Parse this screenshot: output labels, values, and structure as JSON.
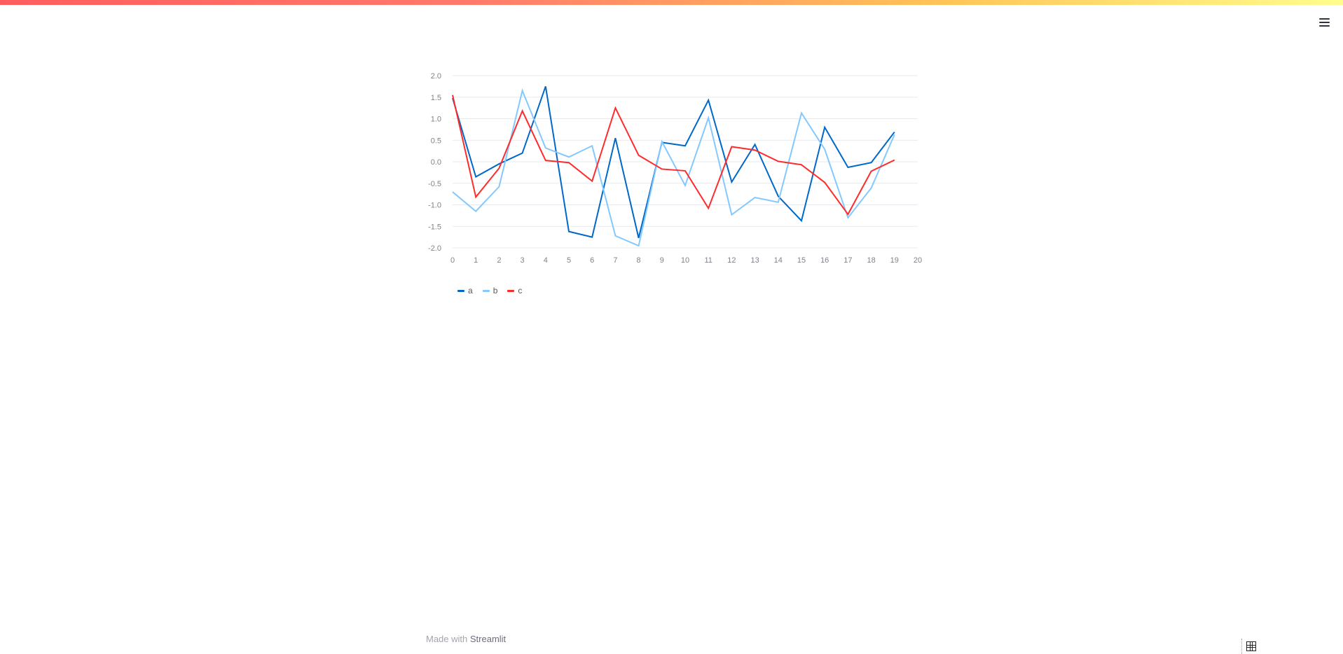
{
  "app": {
    "menu_icon": "hamburger-menu-icon",
    "footer": {
      "prefix": "Made with",
      "link": "Streamlit"
    },
    "status_icon": "grid-icon"
  },
  "chart_data": {
    "type": "line",
    "x": [
      0,
      1,
      2,
      3,
      4,
      5,
      6,
      7,
      8,
      9,
      10,
      11,
      12,
      13,
      14,
      15,
      16,
      17,
      18,
      19
    ],
    "x_ticks": [
      0,
      1,
      2,
      3,
      4,
      5,
      6,
      7,
      8,
      9,
      10,
      11,
      12,
      13,
      14,
      15,
      16,
      17,
      18,
      19,
      20
    ],
    "y_ticks": [
      "2.0",
      "1.5",
      "1.0",
      "0.5",
      "0.0",
      "-0.5",
      "-1.0",
      "-1.5",
      "-2.0"
    ],
    "xlim": [
      0,
      20
    ],
    "ylim": [
      -2.0,
      2.0
    ],
    "grid": "horizontal",
    "legend_placement": "bottom-left",
    "series": [
      {
        "name": "a",
        "color": "#0068c9",
        "values": [
          1.48,
          -0.35,
          -0.05,
          0.2,
          1.75,
          -1.62,
          -1.75,
          0.55,
          -1.77,
          0.45,
          0.37,
          1.43,
          -0.47,
          0.4,
          -0.8,
          -1.37,
          0.8,
          -0.13,
          -0.02,
          0.69
        ]
      },
      {
        "name": "b",
        "color": "#83c9ff",
        "values": [
          -0.7,
          -1.15,
          -0.58,
          1.65,
          0.32,
          0.11,
          0.37,
          -1.72,
          -1.95,
          0.47,
          -0.55,
          1.02,
          -1.23,
          -0.83,
          -0.94,
          1.13,
          0.29,
          -1.3,
          -0.61,
          0.63
        ]
      },
      {
        "name": "c",
        "color": "#ff2b2b",
        "values": [
          1.55,
          -0.82,
          -0.15,
          1.18,
          0.03,
          -0.02,
          -0.45,
          1.25,
          0.15,
          -0.17,
          -0.21,
          -1.08,
          0.35,
          0.27,
          0.01,
          -0.07,
          -0.48,
          -1.22,
          -0.22,
          0.04
        ]
      }
    ]
  }
}
